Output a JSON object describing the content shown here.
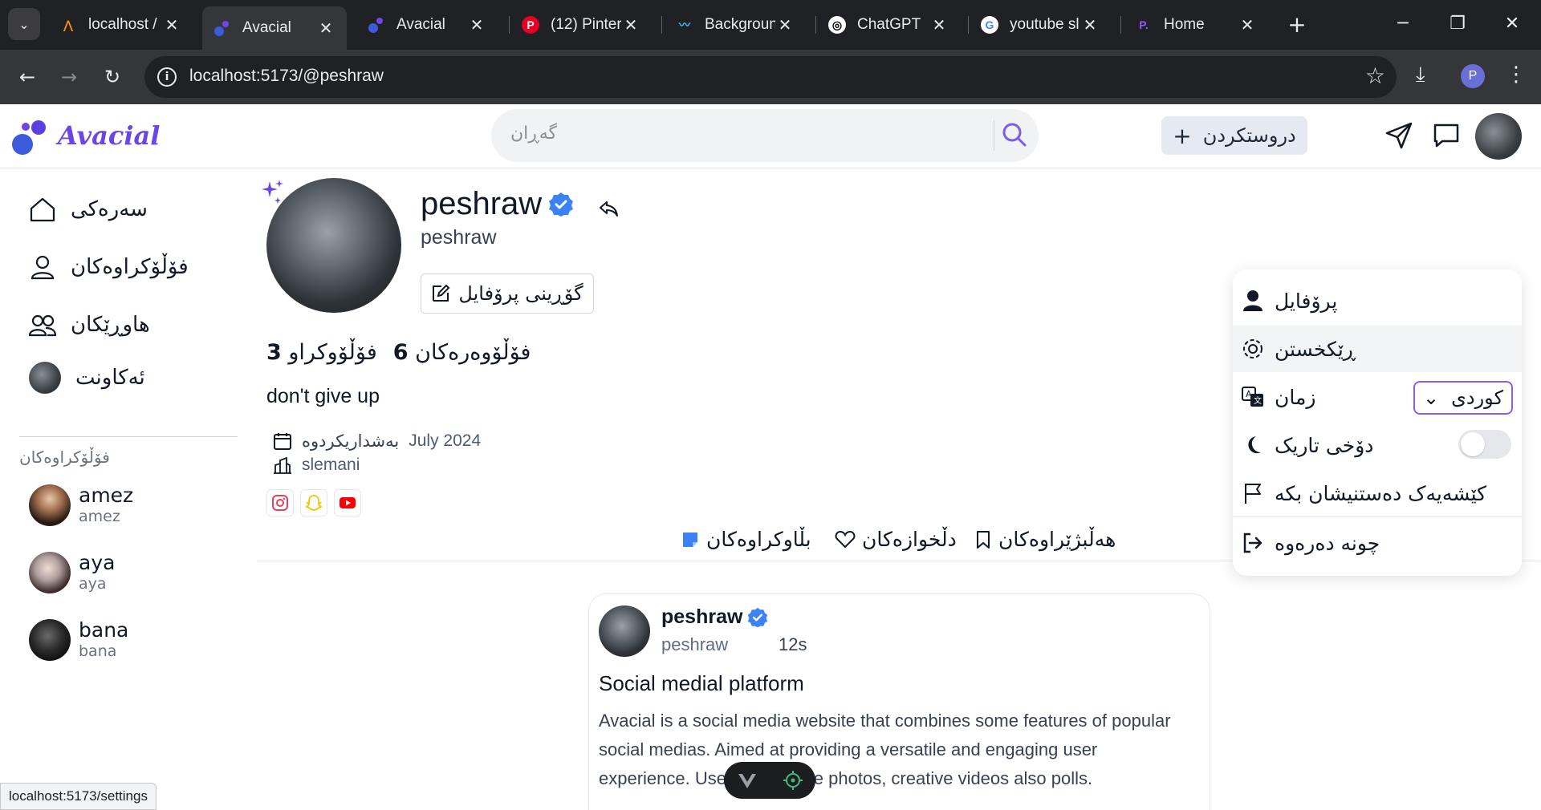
{
  "browser": {
    "tabs": [
      {
        "title": "localhost /",
        "favicon": "phpmyadmin-icon"
      },
      {
        "title": "Avacial",
        "favicon": "avacial-icon",
        "active": true
      },
      {
        "title": "Avacial",
        "favicon": "avacial-icon"
      },
      {
        "title": "(12) Pinter",
        "favicon": "pinterest-icon"
      },
      {
        "title": "Backgroun",
        "favicon": "tailwind-icon"
      },
      {
        "title": "ChatGPT",
        "favicon": "chatgpt-icon"
      },
      {
        "title": "youtube sl",
        "favicon": "google-icon"
      },
      {
        "title": "Home",
        "favicon": "p-icon"
      }
    ],
    "url": "localhost:5173/@peshraw",
    "profile_initial": "P",
    "status_url": "localhost:5173/settings"
  },
  "header": {
    "logo": "Avacial",
    "search_placeholder": "گەڕان",
    "create_label": "دروستکردن",
    "create_plus": "+"
  },
  "sidebar": {
    "items": [
      {
        "label": "سەرەکی",
        "icon": "home-icon"
      },
      {
        "label": "فۆڵۆکراوەکان",
        "icon": "user-icon"
      },
      {
        "label": "هاوڕێکان",
        "icon": "users-icon"
      },
      {
        "label": "ئەکاونت",
        "icon": "avatar"
      }
    ],
    "section_title": "فۆڵۆکراوەکان",
    "following": [
      {
        "name": "amez",
        "handle": "amez"
      },
      {
        "name": "aya",
        "handle": "aya"
      },
      {
        "name": "bana",
        "handle": "bana"
      }
    ]
  },
  "profile": {
    "name": "peshraw",
    "handle": "peshraw",
    "edit_label": "گۆڕینی پرۆفایل",
    "following_count": "3",
    "following_label": "فۆڵۆوکراو",
    "followers_count": "6",
    "followers_label": "فۆڵۆوەرەکان",
    "bio": "don't give up",
    "joined_label": "بەشداریکردوە",
    "joined_date": "July 2024",
    "location": "slemani"
  },
  "profile_tabs": [
    {
      "label": "بڵاوکراوەکان",
      "icon": "post-icon"
    },
    {
      "label": "دڵخوازەکان",
      "icon": "heart-icon"
    },
    {
      "label": "هەڵبژێراوەکان",
      "icon": "bookmark-icon"
    }
  ],
  "post": {
    "author": "peshraw",
    "handle": "peshraw",
    "time": "12s",
    "title": "Social medial platform",
    "body": "Avacial is a social media website that combines some features of popular social medias. Aimed at providing a versatile and engaging user experience. Users can share photos, creative videos also polls."
  },
  "menu": {
    "profile": "پرۆفایل",
    "settings": "ڕێکخستن",
    "language": "زمان",
    "language_value": "کوردی",
    "dark_mode": "دۆخی تاریک",
    "dark_mode_on": false,
    "report": "کێشەیەک دەستنیشان بکە",
    "logout": "چونە دەرەوە"
  },
  "colors": {
    "brand": "#6b46e5",
    "verified": "#3b82f6",
    "select_border": "#8b5cf6"
  }
}
